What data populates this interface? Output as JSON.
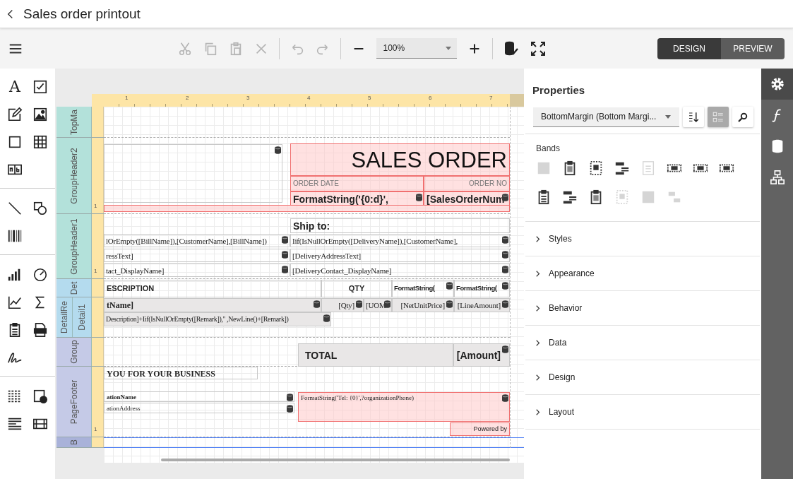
{
  "header": {
    "title": "Sales order printout"
  },
  "toolbar": {
    "edit_actions": [
      {
        "kind": "cut",
        "disabled": true
      },
      {
        "kind": "copy",
        "disabled": true
      },
      {
        "kind": "paste",
        "disabled": true
      },
      {
        "kind": "delete",
        "disabled": true
      }
    ],
    "history_actions": [
      {
        "kind": "undo",
        "disabled": true
      },
      {
        "kind": "redo",
        "disabled": true
      }
    ],
    "zoom": {
      "value": "100%"
    },
    "extra_actions": [
      {
        "kind": "validate",
        "disabled": false
      },
      {
        "kind": "fullscreen",
        "disabled": false
      }
    ],
    "modes": [
      {
        "label": "DESIGN",
        "selected": true
      },
      {
        "label": "PREVIEW",
        "selected": false
      }
    ]
  },
  "toolbox": [
    [
      {
        "kind": "label",
        "text": "A"
      },
      {
        "kind": "checkbox"
      },
      {
        "kind": "rich-text"
      },
      {
        "kind": "picture"
      },
      {
        "kind": "rectangle"
      },
      {
        "kind": "table"
      },
      {
        "kind": "char-comb"
      }
    ],
    [
      {
        "kind": "line"
      },
      {
        "kind": "shapes"
      },
      {
        "kind": "barcode"
      }
    ],
    [
      {
        "kind": "bar-chart"
      },
      {
        "kind": "gauge"
      },
      {
        "kind": "sparkline"
      },
      {
        "kind": "sigma"
      },
      {
        "kind": "subreport"
      },
      {
        "kind": "pdf"
      },
      {
        "kind": "signature"
      }
    ],
    [
      {
        "kind": "toc"
      },
      {
        "kind": "page-info"
      },
      {
        "kind": "levels"
      },
      {
        "kind": "cross-band"
      }
    ]
  ],
  "ruler": {
    "marks": [
      "1",
      "2",
      "3",
      "4",
      "5",
      "6",
      "7"
    ]
  },
  "bands": [
    {
      "label": "TopMa",
      "color": "#b3e1da",
      "selected": false
    },
    {
      "label": "GroupHeader2",
      "color": "#b3e1da",
      "selected": false,
      "ruler_mark": "1"
    },
    {
      "label": "GroupHeader1",
      "color": "#b3e1da",
      "selected": false,
      "ruler_mark": "1"
    },
    {
      "label": "Det",
      "color": "#b4dbee",
      "selected": false
    },
    {
      "label": "DetailRe",
      "color": "#b4dbee",
      "selected": false,
      "children": [
        {
          "label": "Detail1",
          "color": "#b4dbee"
        }
      ]
    },
    {
      "label": "Group",
      "color": "#c5cae7",
      "selected": false
    },
    {
      "label": "PageFooter",
      "color": "#c5cae7",
      "selected": false,
      "ruler_mark": "1"
    },
    {
      "label": "B",
      "color": "#a9b2d9",
      "selected": true
    }
  ],
  "controls": [
    {
      "kind": "box",
      "overlapping": false,
      "shaded": false,
      "bound": true
    },
    {
      "kind": "title",
      "text": "SALES ORDER",
      "overlapping": true,
      "shaded": false,
      "bound": false
    },
    {
      "kind": "caption",
      "text": "ORDER DATE",
      "overlapping": true,
      "shaded": false,
      "bound": false
    },
    {
      "kind": "caption",
      "text": "ORDER NO",
      "overlapping": true,
      "shaded": false,
      "bound": false
    },
    {
      "kind": "field",
      "text": "FormatString('{0:d}',",
      "overlapping": true,
      "shaded": false,
      "bound": true
    },
    {
      "kind": "field",
      "text": "[SalesOrderNum",
      "overlapping": true,
      "shaded": false,
      "bound": true
    },
    {
      "kind": "box",
      "overlapping": true,
      "shaded": false,
      "bound": false
    },
    {
      "kind": "field",
      "text": "Ship to:",
      "overlapping": false,
      "shaded": false,
      "bound": false
    },
    {
      "kind": "expression",
      "text": "lOrEmpty([BillName]),[CustomerName],[BillName])",
      "overlapping": false,
      "shaded": false,
      "bound": true
    },
    {
      "kind": "expression",
      "text": "Iif(IsNullOrEmpty([DeliveryName]),[CustomerName],",
      "overlapping": false,
      "shaded": false,
      "bound": true
    },
    {
      "kind": "expression",
      "text": "ressText]",
      "overlapping": false,
      "shaded": false,
      "bound": true
    },
    {
      "kind": "expression",
      "text": "[DeliveryAddressText]",
      "overlapping": false,
      "shaded": false,
      "bound": true
    },
    {
      "kind": "expression",
      "text": "tact_DisplayName]",
      "overlapping": false,
      "shaded": false,
      "bound": true
    },
    {
      "kind": "expression",
      "text": "[DeliveryContact_DisplayName]",
      "overlapping": false,
      "shaded": false,
      "bound": true
    },
    {
      "kind": "header",
      "text": "ESCRIPTION",
      "overlapping": false,
      "shaded": false,
      "bound": false
    },
    {
      "kind": "header",
      "text": "QTY",
      "overlapping": false,
      "shaded": false,
      "bound": false
    },
    {
      "kind": "header",
      "text": "FormatString(",
      "overlapping": false,
      "shaded": false,
      "bound": true
    },
    {
      "kind": "header",
      "text": "FormatString(",
      "overlapping": false,
      "shaded": false,
      "bound": true
    },
    {
      "kind": "expression-bold",
      "text": "tName]",
      "overlapping": false,
      "shaded": true,
      "bound": true
    },
    {
      "kind": "expression-compact",
      "text": "Description]+Iif(IsNullOrEmpty([Remark]),'' ,NewLine()+[Remark])",
      "overlapping": false,
      "shaded": true,
      "bound": true
    },
    {
      "kind": "expression",
      "text": "[Qty]",
      "overlapping": false,
      "shaded": true,
      "bound": true
    },
    {
      "kind": "expression",
      "text": "[UOM",
      "overlapping": false,
      "shaded": true,
      "bound": true
    },
    {
      "kind": "expression",
      "text": "[NetUnitPrice]",
      "overlapping": false,
      "shaded": true,
      "bound": true
    },
    {
      "kind": "expression",
      "text": "[LineAmount]",
      "overlapping": false,
      "shaded": true,
      "bound": true
    },
    {
      "kind": "total",
      "text": "TOTAL",
      "overlapping": false,
      "shaded": true,
      "bound": false
    },
    {
      "kind": "total",
      "text": "[Amount]",
      "overlapping": false,
      "shaded": true,
      "bound": true
    },
    {
      "kind": "expression-bold",
      "text": "YOU FOR YOUR BUSINESS",
      "overlapping": false,
      "shaded": false,
      "bound": false
    },
    {
      "kind": "small-bold",
      "text": "ationName",
      "overlapping": false,
      "shaded": false,
      "bound": true
    },
    {
      "kind": "small",
      "text": "ationAddress",
      "overlapping": false,
      "shaded": false,
      "bound": true
    },
    {
      "kind": "small",
      "text": "FormatString('Tel: {0}',?organizationPhone)",
      "overlapping": true,
      "shaded": false,
      "bound": true
    },
    {
      "kind": "note",
      "text": "Powered by",
      "overlapping": true,
      "shaded": false,
      "bound": false
    }
  ],
  "properties": {
    "title": "Properties",
    "selector": "BottomMargin (Bottom Margi...",
    "tools": [
      {
        "kind": "sort",
        "selected": false
      },
      {
        "kind": "categories",
        "selected": true
      },
      {
        "kind": "search",
        "selected": false
      }
    ],
    "bands_heading": "Bands",
    "band_tools": [
      {
        "kind": "block",
        "disabled": true
      },
      {
        "kind": "clipboard",
        "disabled": false
      },
      {
        "kind": "dashed-frame",
        "disabled": false
      },
      {
        "kind": "bars",
        "disabled": false
      },
      {
        "kind": "page",
        "disabled": true
      },
      {
        "kind": "dashed-band",
        "disabled": false
      },
      {
        "kind": "dashed-band",
        "disabled": false
      },
      {
        "kind": "dashed-band",
        "disabled": false
      },
      {
        "kind": "clipboard-lines",
        "disabled": false
      },
      {
        "kind": "bars",
        "disabled": false
      },
      {
        "kind": "clipboard",
        "disabled": false
      },
      {
        "kind": "dashed-frame",
        "disabled": true
      },
      {
        "kind": "block",
        "disabled": true
      },
      {
        "kind": "stack",
        "disabled": true
      }
    ],
    "sections": [
      {
        "label": "Styles",
        "expanded": false
      },
      {
        "label": "Appearance",
        "expanded": false
      },
      {
        "label": "Behavior",
        "expanded": false
      },
      {
        "label": "Data",
        "expanded": false
      },
      {
        "label": "Design",
        "expanded": false
      },
      {
        "label": "Layout",
        "expanded": false
      }
    ]
  },
  "side_tabs": [
    {
      "kind": "settings",
      "selected": true
    },
    {
      "kind": "function",
      "selected": false
    },
    {
      "kind": "database",
      "selected": false
    },
    {
      "kind": "structure",
      "selected": false
    }
  ]
}
